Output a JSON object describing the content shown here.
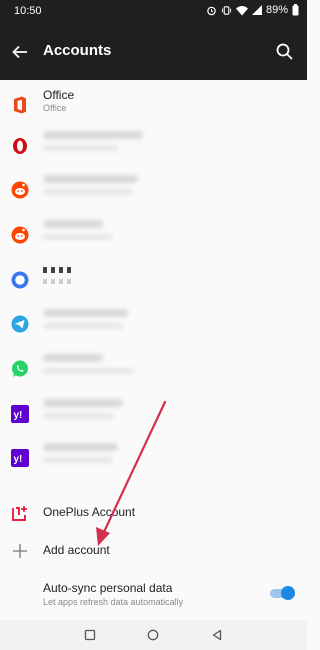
{
  "status": {
    "time": "10:50",
    "battery": "89%"
  },
  "appbar": {
    "title": "Accounts"
  },
  "accounts": [
    {
      "name": "Office",
      "sub": "Office",
      "icon": "office-icon",
      "color": "#e64a19"
    },
    {
      "name": "",
      "sub": "",
      "icon": "opera-icon",
      "color": "#cc0f16"
    },
    {
      "name": "",
      "sub": "",
      "icon": "reddit-icon",
      "color": "#ff4500"
    },
    {
      "name": "",
      "sub": "",
      "icon": "reddit-icon",
      "color": "#ff4500"
    },
    {
      "name": "",
      "sub": "",
      "icon": "signal-icon",
      "color": "#3a76f0"
    },
    {
      "name": "",
      "sub": "",
      "icon": "telegram-icon",
      "color": "#2ca5e0"
    },
    {
      "name": "",
      "sub": "",
      "icon": "whatsapp-icon",
      "color": "#25d366"
    },
    {
      "name": "",
      "sub": "",
      "icon": "yahoo-icon",
      "color": "#5f01d1"
    },
    {
      "name": "",
      "sub": "",
      "icon": "yahoo-icon",
      "color": "#5f01d1"
    },
    {
      "name": "OnePlus Account",
      "sub": "",
      "icon": "oneplus-icon",
      "color": "#eb0029"
    }
  ],
  "add_account": {
    "label": "Add account",
    "icon": "plus-icon"
  },
  "auto_sync": {
    "title": "Auto-sync personal data",
    "subtitle": "Let apps refresh data automatically",
    "enabled": true
  },
  "accent": "#1e88e5"
}
